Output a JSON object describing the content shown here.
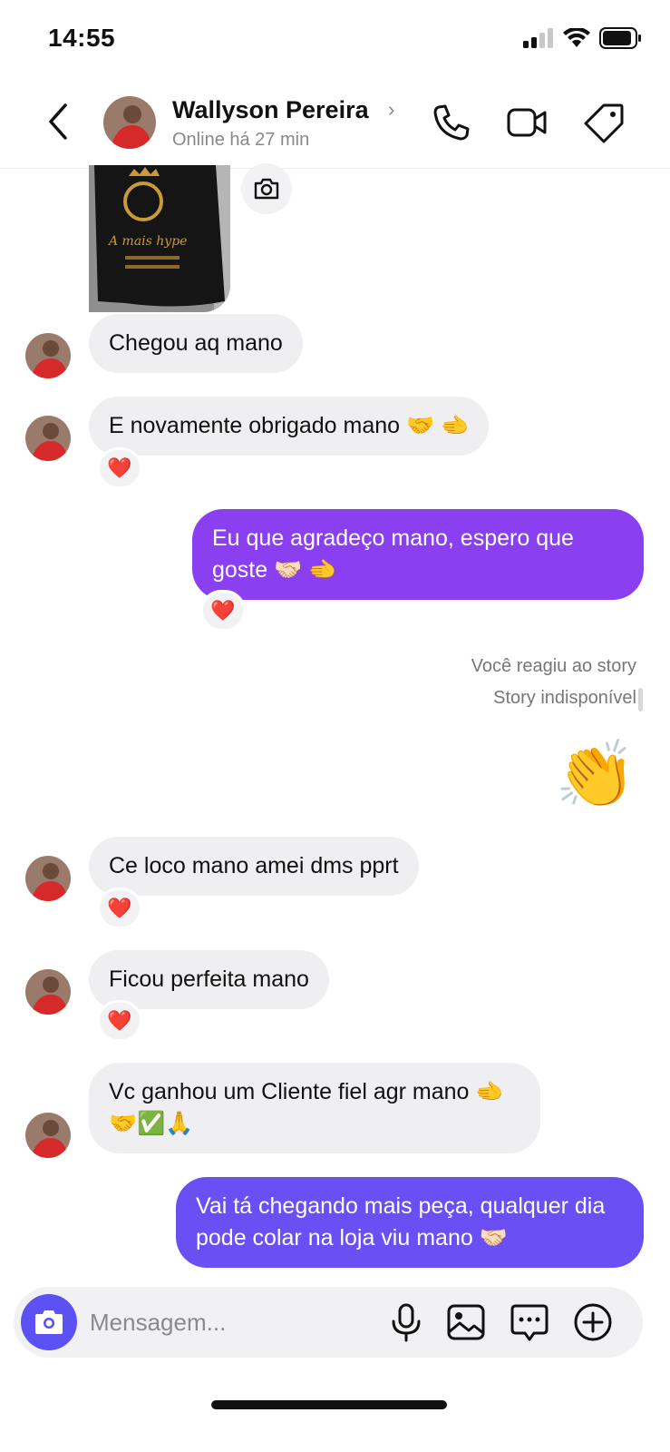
{
  "status_bar": {
    "time": "14:55"
  },
  "header": {
    "contact_name": "Wallyson Pereira",
    "contact_status": "Online há 27 min"
  },
  "messages": {
    "m1": "Chegou aq mano",
    "m2": "E novamente obrigado mano 🤝 🫲",
    "m3": "Eu que agradeço mano, espero que goste 🤝🏻 🫲",
    "story_note_1": "Você reagiu ao story",
    "story_note_2": "Story indisponível",
    "m4": "👏",
    "m5": "Ce loco mano amei dms pprt",
    "m6": "Ficou perfeita mano",
    "m7": "Vc ganhou um Cliente fiel agr mano 🫲🤝✅🙏",
    "m8": "Vai tá chegando mais peça, qualquer dia pode colar na loja viu mano 🤝🏻"
  },
  "reactions": {
    "heart": "❤️"
  },
  "composer": {
    "placeholder": "Mensagem..."
  },
  "colors": {
    "outgoing_purple": "#8a3ff0",
    "outgoing_indigo": "#6a4ff5",
    "camera_button": "#5b51f5"
  }
}
